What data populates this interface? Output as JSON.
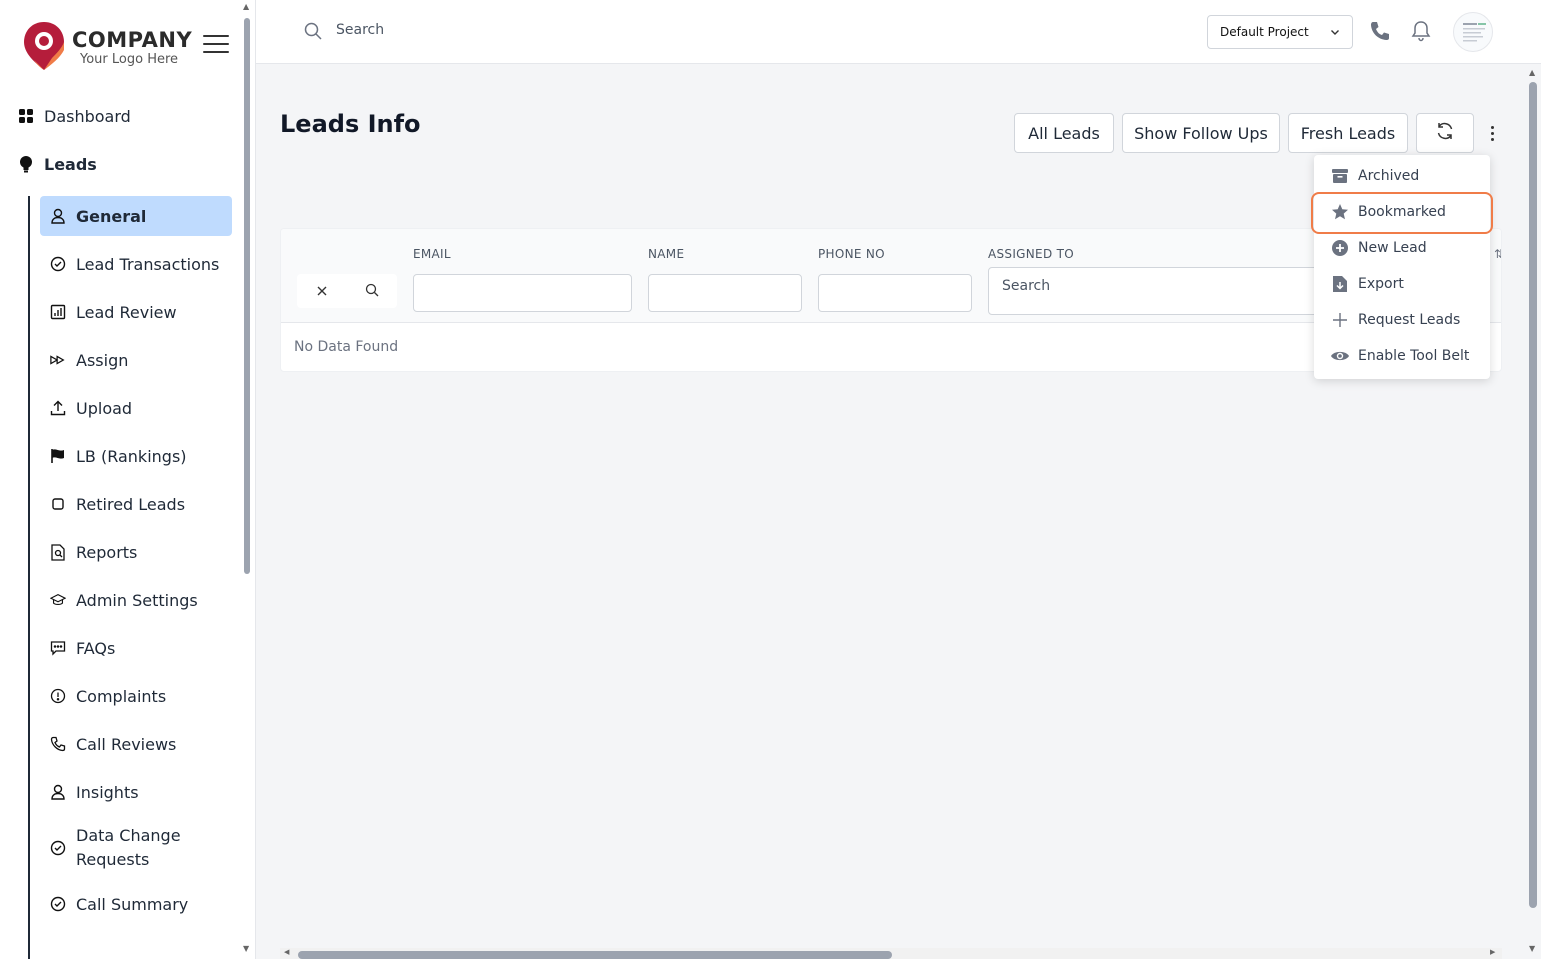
{
  "brand": {
    "title": "COMPANY",
    "subtitle": "Your Logo Here",
    "colors": {
      "pin_red": "#b51d3b",
      "pin_orange": "#f07c48"
    }
  },
  "sidebar": {
    "top_items": [
      {
        "label": "Dashboard",
        "icon": "grid-icon"
      },
      {
        "label": "Leads",
        "icon": "bulb-icon"
      }
    ],
    "items": [
      {
        "label": "General",
        "icon": "user-icon",
        "active": true
      },
      {
        "label": "Lead Transactions",
        "icon": "check-circle-icon"
      },
      {
        "label": "Lead Review",
        "icon": "chart-icon"
      },
      {
        "label": "Assign",
        "icon": "forward-icon"
      },
      {
        "label": "Upload",
        "icon": "upload-icon"
      },
      {
        "label": "LB (Rankings)",
        "icon": "flag-icon"
      },
      {
        "label": "Retired Leads",
        "icon": "square-icon"
      },
      {
        "label": "Reports",
        "icon": "file-search-icon"
      },
      {
        "label": "Admin Settings",
        "icon": "graduation-icon"
      },
      {
        "label": "FAQs",
        "icon": "chat-icon"
      },
      {
        "label": "Complaints",
        "icon": "alert-circle-icon"
      },
      {
        "label": "Call Reviews",
        "icon": "phone-icon"
      },
      {
        "label": "Insights",
        "icon": "user-icon"
      },
      {
        "label": "Data Change Requests",
        "icon": "check-circle-icon"
      },
      {
        "label": "Call Summary",
        "icon": "check-circle-icon"
      }
    ]
  },
  "header": {
    "search_placeholder": "Search",
    "project": "Default Project"
  },
  "main": {
    "title": "Leads Info",
    "buttons": {
      "all_leads": "All Leads",
      "follow_ups": "Show Follow Ups",
      "fresh_leads": "Fresh Leads"
    },
    "table": {
      "columns": [
        "EMAIL",
        "NAME",
        "PHONE NO",
        "ASSIGNED TO"
      ],
      "assigned_placeholder": "Search",
      "empty_text": "No Data Found"
    }
  },
  "menu": {
    "items": [
      {
        "label": "Archived",
        "icon": "archive-icon"
      },
      {
        "label": "Bookmarked",
        "icon": "star-icon",
        "highlighted": true
      },
      {
        "label": "New Lead",
        "icon": "plus-circle-icon"
      },
      {
        "label": "Export",
        "icon": "file-download-icon"
      },
      {
        "label": "Request Leads",
        "icon": "plus-icon"
      },
      {
        "label": "Enable Tool Belt",
        "icon": "eye-icon"
      }
    ]
  },
  "colors": {
    "active_bg": "#bfdbfe",
    "highlight": "#f07c48"
  }
}
